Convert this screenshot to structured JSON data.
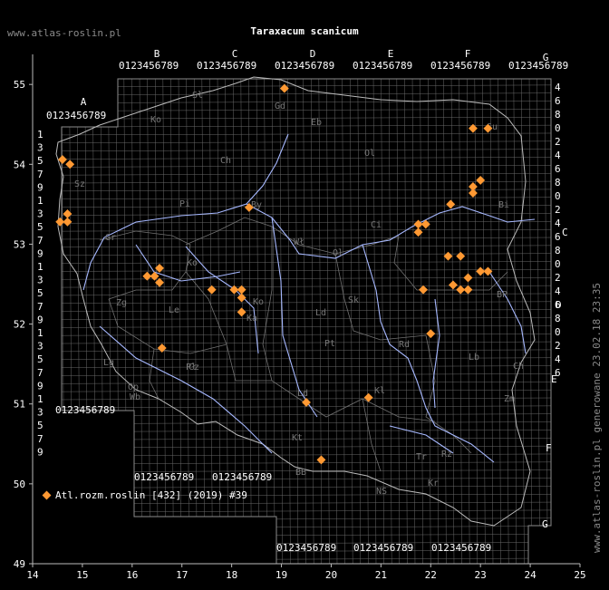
{
  "site": "www.atlas-roslin.pl",
  "title": "Taraxacum scanicum",
  "generated": "www.atlas-roslin.pl generowane 23.02.18 23:35",
  "legend": "Atl.rozm.roslin [432] (2019) #39",
  "colors": {
    "background": "#000000",
    "grid": "#8c8c8c",
    "river": "#a6b8ff",
    "marker": "#ff9933",
    "text": "#ffffff",
    "muted": "#8a8a8a"
  },
  "lon_axis": {
    "ticks": [
      14,
      15,
      16,
      17,
      18,
      19,
      20,
      21,
      22,
      23,
      24,
      25
    ]
  },
  "lat_axis": {
    "ticks": [
      49,
      50,
      51,
      52,
      53,
      54,
      55
    ]
  },
  "top_digits": "0123456789",
  "grid_letters_top": [
    "A",
    "B",
    "C",
    "D",
    "E",
    "F",
    "G"
  ],
  "grid_letters_right": [
    "C",
    "D",
    "E",
    "F",
    "G"
  ],
  "right_digits": [
    "4",
    "6",
    "8",
    "0",
    "2",
    "4",
    "6",
    "8",
    "0",
    "2",
    "4",
    "6",
    "8",
    "0",
    "2",
    "4",
    "6",
    "8",
    "0",
    "2",
    "4",
    "6"
  ],
  "left_digits": [
    "1",
    "3",
    "5",
    "7",
    "9",
    "1",
    "3",
    "5",
    "7",
    "9",
    "1",
    "3",
    "5",
    "7",
    "9",
    "1",
    "3",
    "5",
    "7",
    "9",
    "1",
    "3",
    "5",
    "7",
    "9"
  ],
  "region_labels": [
    "Sł",
    "Gd",
    "Eb",
    "Ko",
    "Ch",
    "Ol",
    "Pi",
    "By",
    "Su",
    "Bi",
    "Ci",
    "Ol",
    "Wł",
    "Sz",
    "Gr",
    "Ko",
    "Ko",
    "Sk",
    "Ld",
    "Zg",
    "Le",
    "Ka",
    "Pt",
    "Rd",
    "Lb",
    "BP",
    "Ch",
    "Zm",
    "Ld",
    "Wb",
    "Op",
    "Cz",
    "Kl",
    "Tr",
    "Kt",
    "BB",
    "NS",
    "Kr",
    "Rz",
    "Lg",
    "Pł"
  ],
  "observations": [
    {
      "lon": 19.06,
      "lat": 54.95
    },
    {
      "lon": 22.85,
      "lat": 54.45
    },
    {
      "lon": 23.15,
      "lat": 54.45
    },
    {
      "lon": 14.6,
      "lat": 54.06
    },
    {
      "lon": 14.75,
      "lat": 54.0
    },
    {
      "lon": 23.0,
      "lat": 53.8
    },
    {
      "lon": 22.85,
      "lat": 53.72
    },
    {
      "lon": 22.85,
      "lat": 53.64
    },
    {
      "lon": 22.4,
      "lat": 53.5
    },
    {
      "lon": 18.35,
      "lat": 53.46
    },
    {
      "lon": 14.7,
      "lat": 53.38
    },
    {
      "lon": 14.55,
      "lat": 53.28
    },
    {
      "lon": 14.7,
      "lat": 53.28
    },
    {
      "lon": 21.75,
      "lat": 53.25
    },
    {
      "lon": 21.9,
      "lat": 53.25
    },
    {
      "lon": 21.75,
      "lat": 53.15
    },
    {
      "lon": 22.35,
      "lat": 52.85
    },
    {
      "lon": 22.6,
      "lat": 52.85
    },
    {
      "lon": 16.55,
      "lat": 52.7
    },
    {
      "lon": 16.3,
      "lat": 52.6
    },
    {
      "lon": 16.45,
      "lat": 52.6
    },
    {
      "lon": 16.55,
      "lat": 52.52
    },
    {
      "lon": 23.0,
      "lat": 52.66
    },
    {
      "lon": 23.15,
      "lat": 52.66
    },
    {
      "lon": 22.75,
      "lat": 52.58
    },
    {
      "lon": 22.45,
      "lat": 52.49
    },
    {
      "lon": 22.6,
      "lat": 52.43
    },
    {
      "lon": 22.75,
      "lat": 52.43
    },
    {
      "lon": 17.6,
      "lat": 52.43
    },
    {
      "lon": 18.05,
      "lat": 52.43
    },
    {
      "lon": 18.2,
      "lat": 52.43
    },
    {
      "lon": 21.85,
      "lat": 52.43
    },
    {
      "lon": 18.2,
      "lat": 52.33
    },
    {
      "lon": 18.2,
      "lat": 52.15
    },
    {
      "lon": 22.0,
      "lat": 51.88
    },
    {
      "lon": 16.6,
      "lat": 51.7
    },
    {
      "lon": 20.75,
      "lat": 51.08
    },
    {
      "lon": 19.5,
      "lat": 51.02
    },
    {
      "lon": 19.8,
      "lat": 50.3
    }
  ]
}
